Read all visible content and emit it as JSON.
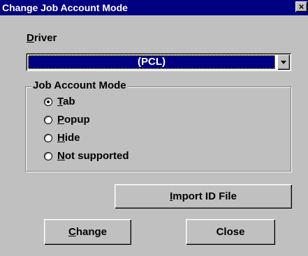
{
  "window": {
    "title": "Change Job Account Mode",
    "close_glyph": "×"
  },
  "driver": {
    "label_mnemonic": "D",
    "label_rest": "river",
    "selected_value": "(PCL)"
  },
  "mode_group": {
    "legend": "Job Account Mode",
    "options": [
      {
        "mnemonic": "T",
        "rest": "ab",
        "checked": true
      },
      {
        "mnemonic": "P",
        "rest": "opup",
        "checked": false
      },
      {
        "mnemonic": "H",
        "rest": "ide",
        "checked": false
      },
      {
        "mnemonic": "N",
        "rest": "ot supported",
        "checked": false
      }
    ]
  },
  "buttons": {
    "import": {
      "mnemonic": "I",
      "rest": "mport ID File"
    },
    "change": {
      "mnemonic": "C",
      "rest": "hange"
    },
    "close": {
      "label": "Close"
    }
  },
  "colors": {
    "titlebar": "#000080",
    "face": "#c0c0c0",
    "selection": "#000080"
  }
}
